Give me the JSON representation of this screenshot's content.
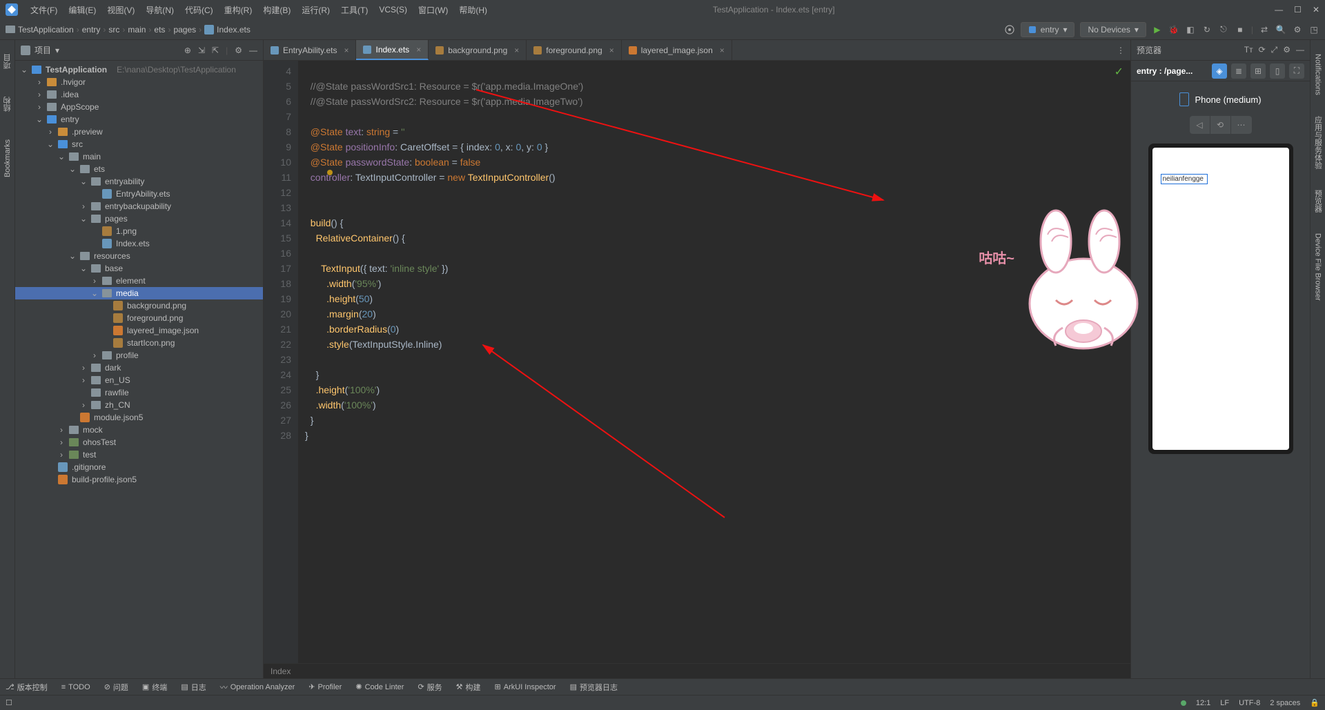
{
  "window": {
    "title": "TestApplication - Index.ets [entry]"
  },
  "menus": [
    "文件(F)",
    "编辑(E)",
    "视图(V)",
    "导航(N)",
    "代码(C)",
    "重构(R)",
    "构建(B)",
    "运行(R)",
    "工具(T)",
    "VCS(S)",
    "窗口(W)",
    "帮助(H)"
  ],
  "breadcrumb": [
    "TestApplication",
    "entry",
    "src",
    "main",
    "ets",
    "pages",
    "Index.ets"
  ],
  "run_config": {
    "module": "entry",
    "device": "No Devices"
  },
  "project": {
    "label": "项目",
    "root": {
      "name": "TestApplication",
      "path": "E:\\nana\\Desktop\\TestApplication"
    },
    "tree": [
      {
        "d": 1,
        "chev": "›",
        "ic": "folder-o",
        "name": ".hvigor"
      },
      {
        "d": 1,
        "chev": "›",
        "ic": "folder",
        "name": ".idea"
      },
      {
        "d": 1,
        "chev": "›",
        "ic": "folder",
        "name": "AppScope"
      },
      {
        "d": 1,
        "chev": "⌄",
        "ic": "folder-b",
        "name": "entry"
      },
      {
        "d": 2,
        "chev": "›",
        "ic": "folder-o",
        "name": ".preview"
      },
      {
        "d": 2,
        "chev": "⌄",
        "ic": "folder-b",
        "name": "src"
      },
      {
        "d": 3,
        "chev": "⌄",
        "ic": "folder",
        "name": "main"
      },
      {
        "d": 4,
        "chev": "⌄",
        "ic": "folder",
        "name": "ets"
      },
      {
        "d": 5,
        "chev": "⌄",
        "ic": "folder",
        "name": "entryability"
      },
      {
        "d": 6,
        "chev": "",
        "ic": "file",
        "name": "EntryAbility.ets"
      },
      {
        "d": 5,
        "chev": "›",
        "ic": "folder",
        "name": "entrybackupability"
      },
      {
        "d": 5,
        "chev": "⌄",
        "ic": "folder",
        "name": "pages"
      },
      {
        "d": 6,
        "chev": "",
        "ic": "img",
        "name": "1.png"
      },
      {
        "d": 6,
        "chev": "",
        "ic": "file",
        "name": "Index.ets"
      },
      {
        "d": 4,
        "chev": "⌄",
        "ic": "folder",
        "name": "resources"
      },
      {
        "d": 5,
        "chev": "⌄",
        "ic": "folder",
        "name": "base"
      },
      {
        "d": 6,
        "chev": "›",
        "ic": "folder",
        "name": "element"
      },
      {
        "d": 6,
        "chev": "⌄",
        "ic": "folder",
        "name": "media",
        "sel": true
      },
      {
        "d": 7,
        "chev": "",
        "ic": "img",
        "name": "background.png"
      },
      {
        "d": 7,
        "chev": "",
        "ic": "img",
        "name": "foreground.png"
      },
      {
        "d": 7,
        "chev": "",
        "ic": "json",
        "name": "layered_image.json"
      },
      {
        "d": 7,
        "chev": "",
        "ic": "img",
        "name": "startIcon.png"
      },
      {
        "d": 6,
        "chev": "›",
        "ic": "folder",
        "name": "profile"
      },
      {
        "d": 5,
        "chev": "›",
        "ic": "folder",
        "name": "dark"
      },
      {
        "d": 5,
        "chev": "›",
        "ic": "folder",
        "name": "en_US"
      },
      {
        "d": 5,
        "chev": "",
        "ic": "folder",
        "name": "rawfile"
      },
      {
        "d": 5,
        "chev": "›",
        "ic": "folder",
        "name": "zh_CN"
      },
      {
        "d": 4,
        "chev": "",
        "ic": "json",
        "name": "module.json5"
      },
      {
        "d": 3,
        "chev": "›",
        "ic": "folder",
        "name": "mock"
      },
      {
        "d": 3,
        "chev": "›",
        "ic": "folder-t",
        "name": "ohosTest"
      },
      {
        "d": 3,
        "chev": "›",
        "ic": "folder-t",
        "name": "test"
      },
      {
        "d": 2,
        "chev": "",
        "ic": "file",
        "name": ".gitignore"
      },
      {
        "d": 2,
        "chev": "",
        "ic": "json",
        "name": "build-profile.json5"
      }
    ]
  },
  "tabs": [
    {
      "name": "EntryAbility.ets",
      "ic": "file"
    },
    {
      "name": "Index.ets",
      "ic": "file",
      "active": true
    },
    {
      "name": "background.png",
      "ic": "img"
    },
    {
      "name": "foreground.png",
      "ic": "img"
    },
    {
      "name": "layered_image.json",
      "ic": "json"
    }
  ],
  "gutter_lines": [
    "4",
    "5",
    "6",
    "7",
    "8",
    "9",
    "10",
    "11",
    "12",
    "13",
    "14",
    "15",
    "16",
    "17",
    "18",
    "19",
    "20",
    "21",
    "22",
    "23",
    "24",
    "25",
    "26",
    "27",
    "28"
  ],
  "code": {
    "l5": "//@State passWordSrc1: Resource = $r('app.media.ImageOne')",
    "l6": "//@State passWordSrc2: Resource = $r('app.media.ImageTwo')",
    "l8_a": "@State",
    "l8_b": "text",
    "l8_c": "string",
    "l8_d": "''",
    "l9_a": "@State",
    "l9_b": "positionInfo",
    "l9_c": "CaretOffset",
    "l9_d": "{ index:",
    "l9_e": "0",
    "l9_f": ", x:",
    "l9_g": "0",
    "l9_h": ", y:",
    "l9_i": "0",
    "l9_j": " }",
    "l10_a": "@State",
    "l10_b": "passwordState",
    "l10_c": "boolean",
    "l10_d": "false",
    "l11_a": "controller",
    "l11_b": "TextInputController",
    "l11_c": "new",
    "l11_d": "TextInputController",
    "l14_a": "build",
    "l14_b": "() {",
    "l15_a": "RelativeContainer",
    "l15_b": "() {",
    "l17_a": "TextInput",
    "l17_b": "({ text:",
    "l17_c": "'inline style'",
    "l17_d": " })",
    "l18_a": ".width",
    "l18_b": "'95%'",
    "l19_a": ".height",
    "l19_b": "50",
    "l20_a": ".margin",
    "l20_b": "20",
    "l21_a": ".borderRadius",
    "l21_b": "0",
    "l22_a": ".style",
    "l22_b": "TextInputStyle.Inline",
    "l24": "}",
    "l25_a": ".height",
    "l25_b": "'100%'",
    "l26_a": ".width",
    "l26_b": "'100%'",
    "l27": "}",
    "l28": "}"
  },
  "filecrumb": "Index",
  "preview": {
    "title": "预览器",
    "entry": "entry : /page...",
    "device": "Phone (medium)",
    "input_value": "neilianfengge"
  },
  "bunny_text": "咕咕~",
  "bottom_tools": [
    "版本控制",
    "TODO",
    "问题",
    "终端",
    "日志",
    "Operation Analyzer",
    "Profiler",
    "Code Linter",
    "服务",
    "构建",
    "ArkUI Inspector",
    "预览器日志"
  ],
  "status": {
    "pos": "12:1",
    "le": "LF",
    "enc": "UTF-8",
    "indent": "2 spaces"
  }
}
